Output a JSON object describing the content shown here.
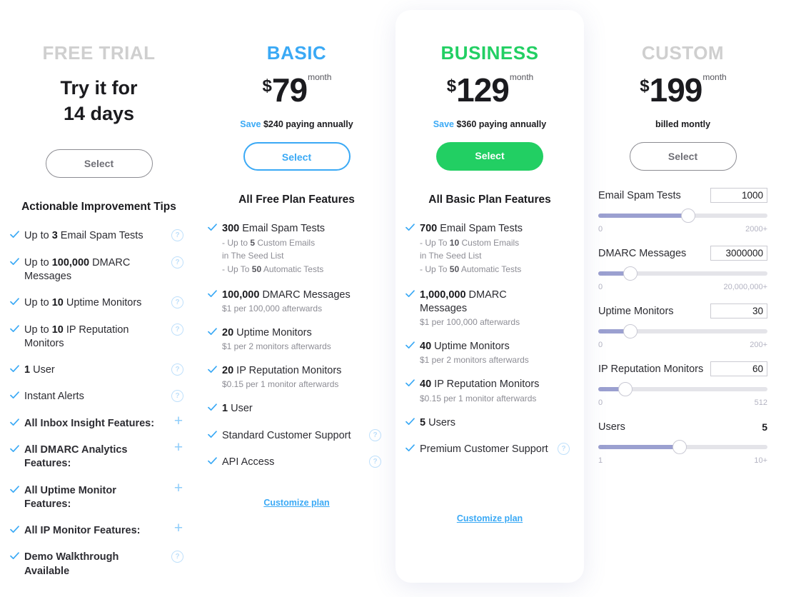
{
  "plans": [
    {
      "name": "FREE TRIAL",
      "trial_line1": "Try it for",
      "trial_line2": "14 days",
      "select_label": "Select",
      "list_title": "Actionable Improvement Tips",
      "features": [
        {
          "pre": "Up to ",
          "strong": "3",
          "post": " Email Spam Tests",
          "aid": "help"
        },
        {
          "pre": "Up to ",
          "strong": "100,000",
          "post": " DMARC Messages",
          "aid": "help"
        },
        {
          "pre": "Up to ",
          "strong": "10",
          "post": " Uptime Monitors",
          "aid": "help"
        },
        {
          "pre": "Up to ",
          "strong": "10",
          "post": " IP Reputation Monitors",
          "aid": "help"
        },
        {
          "pre": "",
          "strong": "1",
          "post": " User",
          "aid": "help"
        },
        {
          "pre": "Instant Alerts",
          "strong": "",
          "post": "",
          "aid": "help"
        },
        {
          "pre": "All Inbox Insight Features:",
          "strong": "",
          "post": "",
          "aid": "plus",
          "bold": true
        },
        {
          "pre": "All DMARC Analytics Features:",
          "strong": "",
          "post": "",
          "aid": "plus",
          "bold": true
        },
        {
          "pre": "All Uptime Monitor Features:",
          "strong": "",
          "post": "",
          "aid": "plus",
          "bold": true
        },
        {
          "pre": "All IP Monitor Features:",
          "strong": "",
          "post": "",
          "aid": "plus",
          "bold": true
        },
        {
          "pre": "Demo Walkthrough Available",
          "strong": "",
          "post": "",
          "aid": "help",
          "bold": true
        }
      ]
    },
    {
      "name": "BASIC",
      "currency": "$",
      "amount": "79",
      "per": "month",
      "save_word": "Save",
      "save_rest": " $240 paying annually",
      "select_label": "Select",
      "list_title": "All Free Plan Features",
      "features": [
        {
          "strong": "300",
          "post": " Email Spam Tests",
          "subs": [
            {
              "pre": "- Up to ",
              "strong": "5",
              "post": " Custom Emails"
            },
            {
              "pre": "  in The Seed List",
              "strong": "",
              "post": ""
            },
            {
              "pre": "- Up To ",
              "strong": "50",
              "post": " Automatic Tests"
            }
          ]
        },
        {
          "strong": "100,000",
          "post": " DMARC Messages",
          "note": "$1 per 100,000 afterwards"
        },
        {
          "strong": "20",
          "post": " Uptime Monitors",
          "note": "$1 per 2 monitors afterwards"
        },
        {
          "strong": "20",
          "post": " IP Reputation Monitors",
          "note": "$0.15 per 1 monitor afterwards"
        },
        {
          "strong": "1",
          "post": " User"
        },
        {
          "strong": "",
          "post": "Standard Customer Support",
          "aid": "help"
        },
        {
          "strong": "",
          "post": "API Access",
          "aid": "help"
        }
      ],
      "customize_label": "Customize plan"
    },
    {
      "name": "BUSINESS",
      "currency": "$",
      "amount": "129",
      "per": "month",
      "save_word": "Save",
      "save_rest": " $360 paying annually",
      "select_label": "Select",
      "list_title": "All Basic Plan Features",
      "features": [
        {
          "strong": "700",
          "post": " Email Spam Tests",
          "subs": [
            {
              "pre": "- Up To ",
              "strong": "10",
              "post": " Custom Emails"
            },
            {
              "pre": "  in The Seed List",
              "strong": "",
              "post": ""
            },
            {
              "pre": "- Up To ",
              "strong": "50",
              "post": " Automatic Tests"
            }
          ]
        },
        {
          "strong": "1,000,000",
          "post": " DMARC Messages",
          "note": "$1 per 100,000 afterwards"
        },
        {
          "strong": "40",
          "post": " Uptime Monitors",
          "note": "$1 per 2 monitors afterwards"
        },
        {
          "strong": "40",
          "post": " IP Reputation Monitors",
          "note": "$0.15 per 1 monitor afterwards"
        },
        {
          "strong": "5",
          "post": " Users"
        },
        {
          "strong": "",
          "post": "Premium Customer Support",
          "aid": "help"
        }
      ],
      "customize_label": "Customize plan"
    },
    {
      "name": "CUSTOM",
      "currency": "$",
      "amount": "199",
      "per": "month",
      "billed": "billed montly",
      "select_label": "Select",
      "sliders": [
        {
          "label": "Email Spam Tests",
          "value": "1000",
          "min": "0",
          "max": "2000+",
          "percent": 53,
          "boxed": true
        },
        {
          "label": "DMARC Messages",
          "value": "3000000",
          "min": "0",
          "max": "20,000,000+",
          "percent": 19,
          "boxed": true
        },
        {
          "label": "Uptime Monitors",
          "value": "30",
          "min": "0",
          "max": "200+",
          "percent": 19,
          "boxed": true
        },
        {
          "label": "IP Reputation Monitors",
          "value": "60",
          "min": "0",
          "max": "512",
          "percent": 16,
          "boxed": true
        },
        {
          "label": "Users",
          "value": "5",
          "min": "1",
          "max": "10+",
          "percent": 48,
          "boxed": false
        }
      ]
    }
  ],
  "colors": {
    "basic_accent": "#3aa9f5",
    "business_accent": "#22cf63",
    "muted_heading": "#cfcfcf",
    "slider_fill": "#9ba0d0",
    "slider_track": "#e4e4e9",
    "check_blue": "#3aa9f5",
    "help_blue": "#bfe0fb"
  },
  "icons": {
    "check": "check-icon",
    "help": "help-icon",
    "plus": "plus-icon"
  }
}
